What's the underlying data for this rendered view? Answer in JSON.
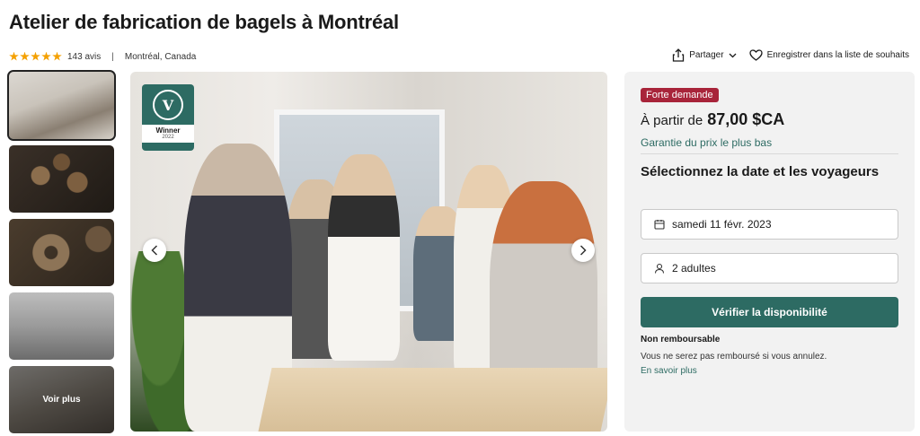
{
  "header": {
    "title": "Atelier de fabrication de bagels à Montréal",
    "rating": 5,
    "reviews": "143 avis",
    "separator": "|",
    "location": "Montréal, Canada"
  },
  "actions": {
    "share_label": "Partager",
    "wishlist_label": "Enregistrer dans la liste de souhaits"
  },
  "gallery": {
    "thumbnails_count": 5,
    "see_more_label": "Voir plus",
    "badge": {
      "logo_letter": "V",
      "title": "Winner",
      "year": "2022"
    }
  },
  "booking": {
    "demand_badge": "Forte demande",
    "price_prefix": "À partir de",
    "price": "87,00 $CA",
    "guarantee": "Garantie du prix le plus bas",
    "select_title": "Sélectionnez la date et les voyageurs",
    "date_value": "samedi 11 févr. 2023",
    "travelers_value": "2 adultes",
    "check_button": "Vérifier la disponibilité",
    "refund_title": "Non remboursable",
    "refund_desc": "Vous ne serez pas remboursé si vous annulez.",
    "learn_more": "En savoir plus"
  },
  "colors": {
    "accent": "#2d6b63",
    "demand": "#a8243a",
    "star": "#f4a000"
  },
  "icons": [
    "star-icon",
    "share-icon",
    "chevron-down-icon",
    "heart-icon",
    "chevron-left-icon",
    "chevron-right-icon",
    "calendar-icon",
    "user-icon"
  ]
}
